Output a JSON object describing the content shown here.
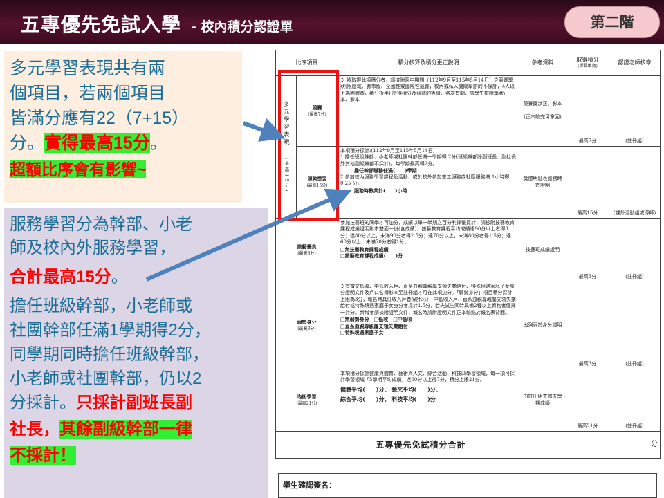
{
  "header": {
    "title": "五專優先免試入學",
    "subtitle": "- 校內積分認證單",
    "badge": "第二階"
  },
  "callout1": {
    "line1": "多元學習表現共有兩",
    "line2": "個項目，若兩個項目",
    "line3": "皆滿分應有22（7+15）",
    "line4a": "分。",
    "line4b": "實得最高15分",
    "line4c": "。",
    "line5": "超額比序會有影響~"
  },
  "callout2": {
    "line1": "服務學習分為幹部、小老",
    "line2": "師及校內外服務學習，",
    "line3a": "合計最高15分",
    "line3b": "。",
    "line4": "擔任班級幹部，小老師或",
    "line5": "社團幹部任滿1學期得2分，",
    "line6": "同學期同時擔任班級幹部，",
    "line7": "小老師或社團幹部，仍以2",
    "line8a": "分採計。",
    "line8b": "只採計副班長副",
    "line9a": "社長，",
    "line9b": "其餘副級幹部一律",
    "line10": "不採計！"
  },
  "form": {
    "headers": {
      "item": "比序項目",
      "desc": "積分核算及積分更正說明",
      "ref": "參考資料",
      "score": "取得積分",
      "score_note": "(師長填寫)",
      "teacher": "認證老師核章"
    },
    "group_label": "多元學習表現",
    "group_max": "(最高15分)",
    "rows": {
      "competition": {
        "name": "競賽",
        "max": "(最高7分)",
        "desc": "※ 欲取得此項積分者，請檢附園中期間（112年9月至115年5月14日）之競賽獎狀(限區域、縣市級、全國性或國際性競賽，校內或私人機關舉辦的不採計，4人以上為團體賽，積分折半) 所得積分及競賽的等級、名次有關，請學生檢附獎狀正本、影本",
        "ref": "競賽獎狀正、影本",
        "ref2": "(正本驗完可拿回)",
        "score": "最高7分",
        "sign": "(註冊組)"
      },
      "service": {
        "name": "服務學習",
        "max": "(最高15分)",
        "intro": "本項積分採計:(112年9月至115年5月14日)",
        "p1": "1.擔任班級幹部、小老師或社團幹部任滿一學期得 2分(班級幹部除副班長、副社長外其他副級幹部不採計)，每學期最高得2分。",
        "p1_fill": "擔任幹部職務任滿(　　)學期",
        "p2": "2.參加校內服務學習課程及活動，或於校外參加志工服務或社區服務滿 1小時得 0.25 分。",
        "p2_fill": "服務時數共計(　　)小時",
        "ref": "獎懲明細表服務時數證明",
        "score": "最高15分",
        "sign": "(課外活動組或導師)"
      },
      "skill": {
        "name": "技藝優良",
        "max": "(最高3分)",
        "desc": "參加技藝班的同學才可加分，成績以單一學期之百分制擇優採計，請檢附技藝教育課程成績證明影本雙面一份(含成績)，技藝教育課程平均成績達90分以上者得3分；達80分以上，未滿90分者得2.5分；達70分以上，未滿80分者得1.5分；達60分以上，未滿70分者得1分。",
        "opt1": "□無技藝教育課程成績",
        "opt2": "□技藝教育課程成績(　　)分",
        "ref": "技藝班成績證明",
        "score": "最高3分",
        "sign": "(註冊組)"
      },
      "weak": {
        "name": "弱勢身分",
        "max": "(最高3分)",
        "desc": "※有徵交低收、中低收入戶、直系血親尊親屬支領失業給付、特殊境遇家庭子女身分證明文件及戶口名簿影本至註冊組才可在此項加分。「弱勢身分」項目積分採計上限為3分，報名時具低收入戶者採計3分，中低收入戶、直系血親尊親屬支領失業給付或特殊境遇家庭子女身分者採計1.5分，若先試生同時具備2種以上資格者僅擇一計分。新增者請檢附證明文件，報名時請附證明文件正本驗點於報名表背面。",
        "opt1": "□無弱勢身分　□低收　□中低收",
        "opt2": "□直系血親尊親屬支領失業給付",
        "opt3": "□特殊境遇家庭子女",
        "ref": "出列弱勢身分證明",
        "score": "最高3分",
        "sign": "(註冊組)"
      },
      "balance": {
        "name": "均衡學習",
        "max": "(最高21分)",
        "desc": "本項積分採計健康與體育、藝術與人文、綜合活動、科技四學習領域，每一項可採計學習領域「5學期平均成績」達60分以上得7分，積分上限21分。",
        "f1": "健體平均(　　)分、 藝文平均(　　)分、",
        "f2": "綜合平均(　　)分、 科技平均(　　)分",
        "ref": "由註冊組查詢五學期成績",
        "score": "最高21分",
        "sign": "(註冊組)"
      }
    },
    "total_label": "五專優先免試積分合計",
    "total_unit": "分",
    "signature": "學生確認簽名："
  }
}
